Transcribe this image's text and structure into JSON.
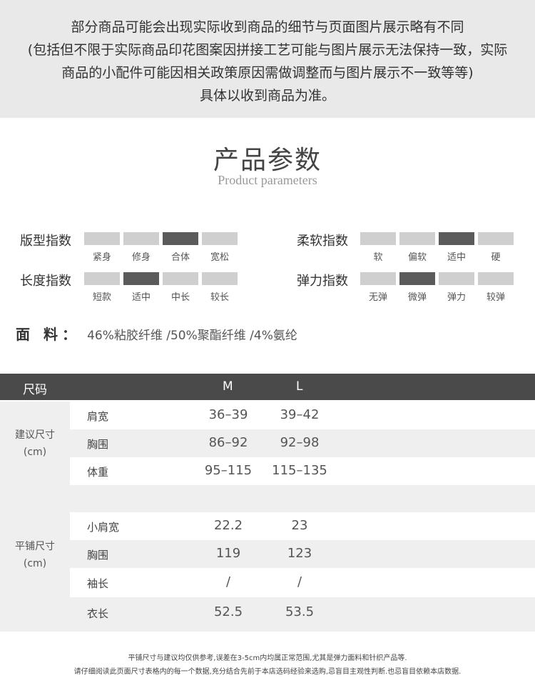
{
  "notice": {
    "lines": [
      "部分商品可能会出现实际收到商品的细节与页面图片展示略有不同",
      "(包括但不限于实际商品印花图案因拼接工艺可能与图片展示无法保持一致，实际",
      "商品的小配件可能因相关政策原因需做调整而与图片展示不一致等等)",
      "具体以收到商品为准。"
    ]
  },
  "heading": {
    "title": "产品参数",
    "subtitle": "Product parameters"
  },
  "indices": [
    {
      "label": "版型指数",
      "options": [
        "紧身",
        "修身",
        "合体",
        "宽松"
      ],
      "active": 2
    },
    {
      "label": "柔软指数",
      "options": [
        "软",
        "偏软",
        "适中",
        "硬"
      ],
      "active": 2
    },
    {
      "label": "长度指数",
      "options": [
        "短款",
        "适中",
        "中长",
        "较长"
      ],
      "active": 1
    },
    {
      "label": "弹力指数",
      "options": [
        "无弹",
        "微弹",
        "弹力",
        "较弹"
      ],
      "active": 1
    }
  ],
  "fabric": {
    "label": "面 料：",
    "value": "46%粘胶纤维 /50%聚酯纤维 /4%氨纶"
  },
  "size_table": {
    "header": {
      "label": "尺码",
      "sizes": [
        "M",
        "L"
      ]
    },
    "groups": [
      {
        "name": "建议尺寸",
        "unit": "(cm)",
        "rows": [
          {
            "name": "肩宽",
            "M": "36–39",
            "L": "39–42"
          },
          {
            "name": "胸围",
            "M": "86–92",
            "L": "92–98"
          },
          {
            "name": "体重",
            "M": "95–115",
            "L": "115–135"
          }
        ]
      },
      {
        "name": "平铺尺寸",
        "unit": "(cm)",
        "rows": [
          {
            "name": "小肩宽",
            "M": "22.2",
            "L": "23"
          },
          {
            "name": "胸围",
            "M": "119",
            "L": "123"
          },
          {
            "name": "袖长",
            "M": "/",
            "L": "/"
          },
          {
            "name": "衣长",
            "M": "52.5",
            "L": "53.5"
          }
        ]
      }
    ]
  },
  "footer": {
    "line1": "平铺尺寸与建议均仅供参考,误差在3-5cm内均属正常范围,尤其是弹力面料和针织产品等.",
    "line2": "请仔细阅读此页面尺寸表格内的每一个数据,充分结合先前于本店选码经验来选购,忌盲目主观性判断.也忌盲目依赖本店数据."
  },
  "colors": {
    "active_segment": "#5b5b5b",
    "inactive_segment": "#cfcfcf",
    "header_bar": "#4a4a4a",
    "notice_bg": "#e9e9e9"
  }
}
